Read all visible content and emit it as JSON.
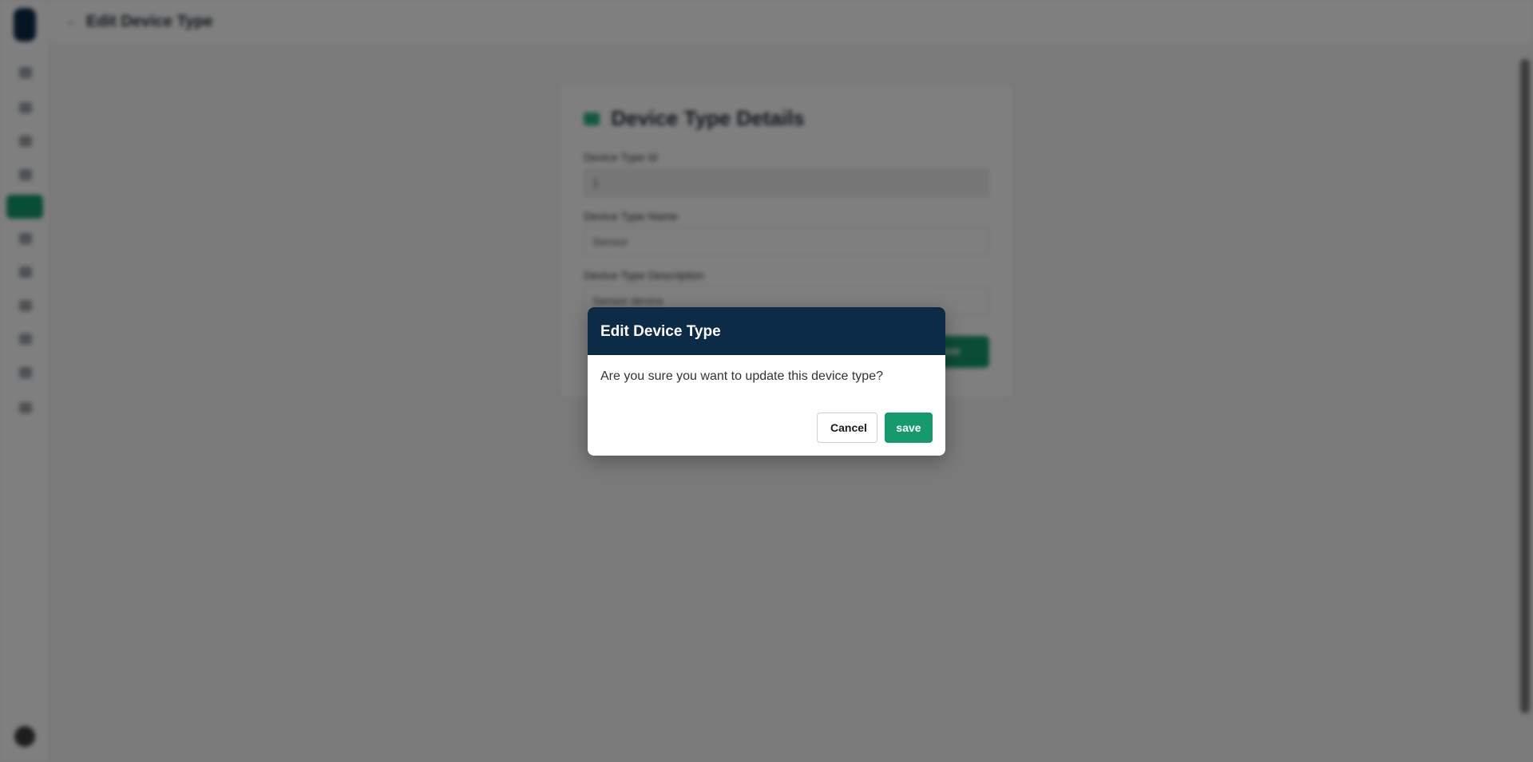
{
  "page": {
    "title": "Edit Device Type"
  },
  "card": {
    "title": "Device Type Details",
    "fields": [
      {
        "label": "Device Type Id",
        "value": "1"
      },
      {
        "label": "Device Type Name",
        "value": "Sensor"
      },
      {
        "label": "Device Type Description",
        "value": "Sensor device"
      }
    ],
    "save_label": "save"
  },
  "modal": {
    "title": "Edit Device Type",
    "message": "Are you sure you want to update this device type?",
    "cancel_label": "Cancel",
    "save_label": "save"
  },
  "colors": {
    "header": "#0b2b47",
    "accent": "#159a6e",
    "overlay": "rgba(0,0,0,0.5)"
  },
  "icons": {
    "back": "arrow-left-icon",
    "title": "device-icon"
  }
}
